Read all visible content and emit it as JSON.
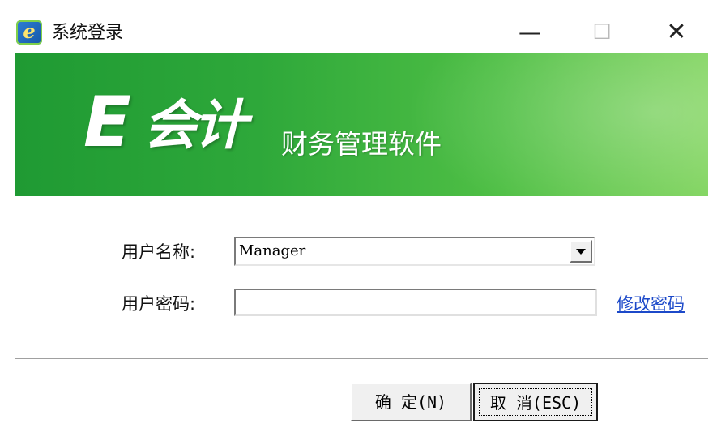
{
  "window": {
    "title": "系统登录",
    "icon": "e-app-icon",
    "icon_glyph": "e",
    "controls": {
      "minimize": "—",
      "maximize": "☐",
      "close": "✕"
    }
  },
  "banner": {
    "brand_letter": "E",
    "brand_name": "会计",
    "subtitle": "财务管理软件"
  },
  "form": {
    "user_label": "用户名称:",
    "user_value": "Manager",
    "password_label": "用户密码:",
    "password_value": "",
    "change_password_link": "修改密码"
  },
  "buttons": {
    "ok_label": "确 定(N)",
    "cancel_label": "取 消(ESC)"
  },
  "colors": {
    "banner_green": "#2ea83a",
    "link_blue": "#1c49c9"
  }
}
